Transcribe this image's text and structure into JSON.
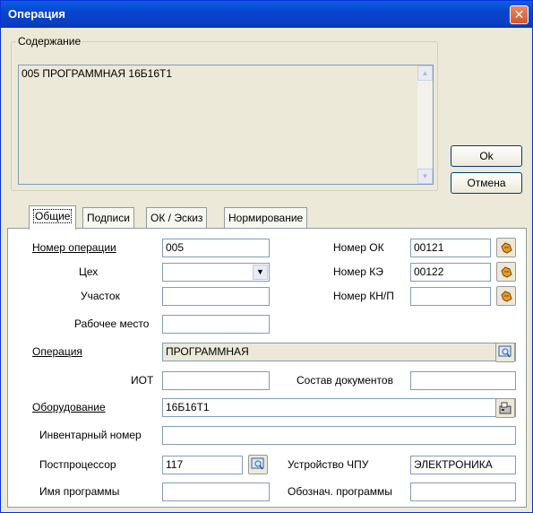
{
  "window": {
    "title": "Операция",
    "close_glyph": "✕"
  },
  "content_group": {
    "legend": "Содержание",
    "text": "005  ПРОГРАММНАЯ 16Б16Т1"
  },
  "buttons": {
    "ok": "Ok",
    "cancel": "Отмена"
  },
  "tabs": [
    {
      "label": "Общие",
      "active": true
    },
    {
      "label": "Подписи",
      "active": false
    },
    {
      "label": "ОК / Эскиз",
      "active": false
    },
    {
      "label": "Нормирование",
      "active": false
    }
  ],
  "form": {
    "op_number": {
      "label": "Номер операции",
      "value": "005"
    },
    "workshop": {
      "label": "Цех",
      "value": ""
    },
    "section": {
      "label": "Участок",
      "value": ""
    },
    "workplace": {
      "label": "Рабочее место",
      "value": ""
    },
    "operation": {
      "label": "Операция",
      "value": "ПРОГРАММНАЯ"
    },
    "iot": {
      "label": "ИОТ",
      "value": ""
    },
    "doc_set": {
      "label": "Состав документов",
      "value": ""
    },
    "equipment": {
      "label": "Оборудование",
      "value": "16Б16Т1"
    },
    "inventory": {
      "label": "Инвентарный номер",
      "value": ""
    },
    "postprocessor": {
      "label": "Постпроцессор",
      "value": "117"
    },
    "cnc_device": {
      "label": "Устройство ЧПУ",
      "value": "ЭЛЕКТРОНИКА"
    },
    "program_name": {
      "label": "Имя программы",
      "value": ""
    },
    "program_code": {
      "label": "Обознач. программы",
      "value": ""
    },
    "ok_number": {
      "label": "Номер ОК",
      "value": "00121"
    },
    "ke_number": {
      "label": "Номер КЭ",
      "value": "00122"
    },
    "knp_number": {
      "label": "Номер КН/П",
      "value": ""
    }
  },
  "icons": {
    "pick": "hand-pointer-icon",
    "browse": "magnifier-window-icon",
    "equipment": "machine-icon"
  },
  "colors": {
    "titlebar": "#0845cf",
    "panel": "#ece9d8",
    "field_border": "#7f9db9"
  }
}
